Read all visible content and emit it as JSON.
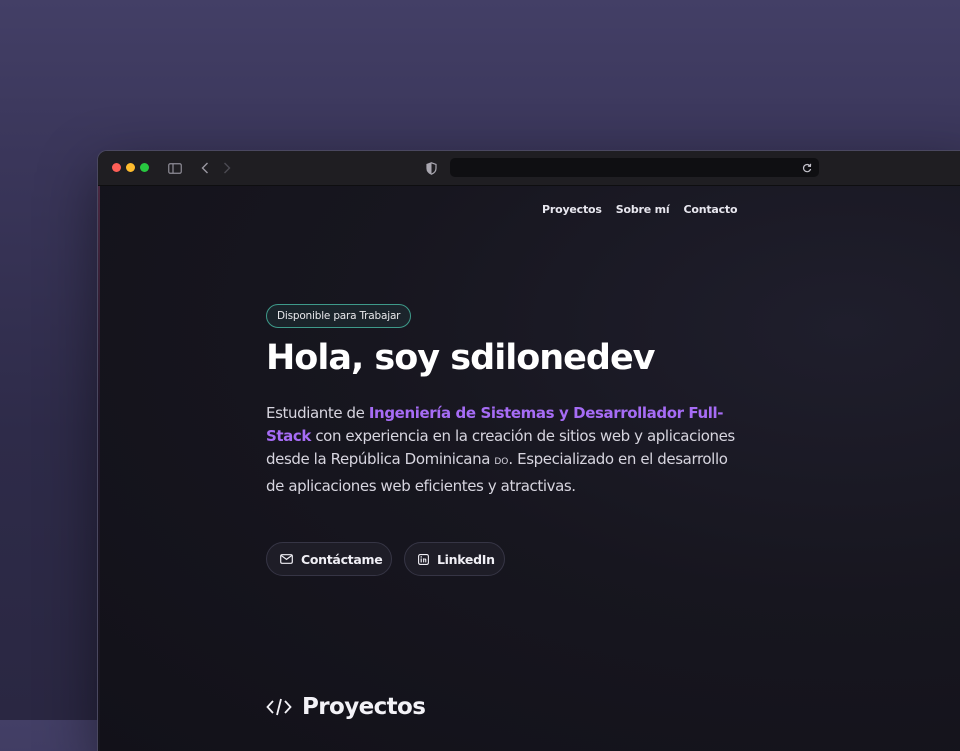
{
  "browser": {
    "address": "",
    "icons": [
      "close-dot",
      "minimize-dot",
      "zoom-dot",
      "sidebar-toggle-icon",
      "back-icon",
      "forward-icon",
      "shield-icon",
      "reload-icon"
    ]
  },
  "nav": {
    "items": [
      {
        "label": "Proyectos"
      },
      {
        "label": "Sobre mí"
      },
      {
        "label": "Contacto"
      }
    ]
  },
  "hero": {
    "badge": "Disponible para Trabajar",
    "title": "Hola, soy sdilonedev",
    "description": {
      "part1": "Estudiante de ",
      "highlight": "Ingeniería de Sistemas y Desarrollador Full-Stack",
      "part2": " con experiencia en la creación de sitios web y aplicaciones desde la República Dominicana ",
      "flag": "DO",
      "part3": ". Especializado en el desarrollo de aplicaciones web eficientes y atractivas."
    },
    "buttons": {
      "contact": "Contáctame",
      "linkedin": "LinkedIn"
    }
  },
  "projects": {
    "heading": "Proyectos"
  },
  "colors": {
    "accent": "#a66cf5",
    "badge_border": "#3e9a8a",
    "background": "#17161f"
  }
}
